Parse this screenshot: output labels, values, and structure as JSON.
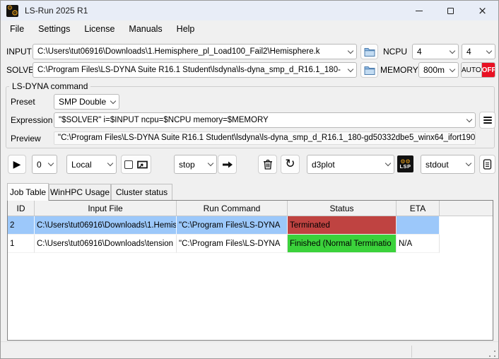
{
  "window": {
    "title": "LS-Run 2025 R1"
  },
  "menu": {
    "items": [
      "File",
      "Settings",
      "License",
      "Manuals",
      "Help"
    ]
  },
  "io": {
    "input_label": "INPUT",
    "input_value": "C:\\Users\\tut06916\\Downloads\\1.Hemisphere_pl_Load100_Fail2\\Hemisphere.k",
    "solver_label": "SOLVER",
    "solver_value": "C:\\Program Files\\LS-DYNA Suite R16.1 Student\\lsdyna\\ls-dyna_smp_d_R16.1_180-",
    "ncpu_label": "NCPU",
    "ncpu_value1": "4",
    "ncpu_value2": "4",
    "memory_label": "MEMORY",
    "memory_value": "800m",
    "auto_label": "AUTO",
    "auto_state": "OFF"
  },
  "command": {
    "group_title": "LS-DYNA command",
    "preset_label": "Preset",
    "preset_value": "SMP Double",
    "expression_label": "Expression",
    "expression_value": "\"$SOLVER\" i=$INPUT ncpu=$NCPU memory=$MEMORY",
    "preview_label": "Preview",
    "preview_value": "\"C:\\Program Files\\LS-DYNA Suite R16.1 Student\\lsdyna\\ls-dyna_smp_d_R16.1_180-gd50332dbe5_winx64_ifort190"
  },
  "toolbar": {
    "queue_value": "0",
    "target_value": "Local",
    "signal_value": "stop",
    "result_value": "d3plot",
    "output_value": "stdout",
    "lsp_label": "LSP"
  },
  "tabs": [
    {
      "label": "Job Table"
    },
    {
      "label": "WinHPC Usage"
    },
    {
      "label": "Cluster status"
    }
  ],
  "table": {
    "columns": [
      "ID",
      "Input File",
      "Run Command",
      "Status",
      "ETA"
    ],
    "rows": [
      {
        "id": "2",
        "input_file": "C:\\Users\\tut06916\\Downloads\\1.Hemis",
        "run_command": "\"C:\\Program Files\\LS-DYNA",
        "status": "Terminated",
        "status_color": "#bf4341",
        "eta": ""
      },
      {
        "id": "1",
        "input_file": "C:\\Users\\tut06916\\Downloads\\tension",
        "run_command": "\"C:\\Program Files\\LS-DYNA",
        "status": "Finished (Normal Terminatio",
        "status_color": "#3bd23b",
        "eta": "N/A"
      }
    ]
  },
  "colors": {
    "selection": "#9cc8fa",
    "terminated": "#bf4341",
    "finished": "#3bd23b",
    "auto_off_red": "#e81123",
    "titlebar": "#e8edf7",
    "icon_orange": "#f2a71b"
  }
}
